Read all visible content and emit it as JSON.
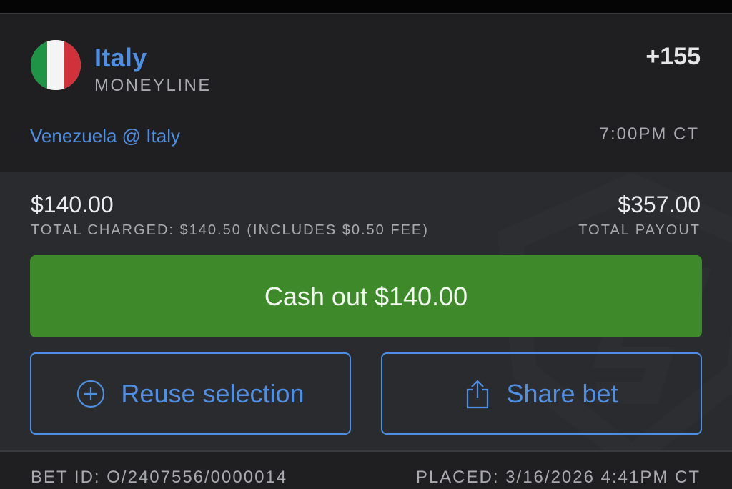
{
  "leg": {
    "flag_icon": "italy-flag-icon",
    "flag_colors": [
      "#1f9446",
      "#f4f4f4",
      "#d0313a"
    ],
    "selection_name": "Italy",
    "market": "MONEYLINE",
    "odds": "+155",
    "matchup": "Venezuela @ Italy",
    "start_time": "7:00PM CT"
  },
  "summary": {
    "wager": "$140.00",
    "total_charged": "TOTAL CHARGED: $140.50 (INCLUDES $0.50 FEE)",
    "payout": "$357.00",
    "payout_label": "TOTAL PAYOUT"
  },
  "actions": {
    "cash_out_label": "Cash out $140.00",
    "reuse_label": "Reuse selection",
    "reuse_icon": "plus-circle-icon",
    "share_label": "Share bet",
    "share_icon": "share-icon"
  },
  "footer": {
    "bet_id": "BET ID: O/2407556/0000014",
    "placed": "PLACED: 3/16/2026 4:41PM CT"
  },
  "colors": {
    "accent_blue": "#4f8fe3",
    "cash_out_green": "#3e8a2b",
    "background": "#2a2b2e"
  }
}
